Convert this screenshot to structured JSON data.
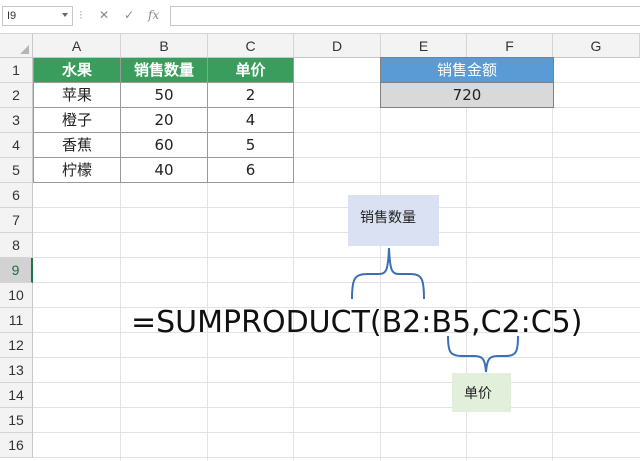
{
  "formula_bar": {
    "name_box": "I9",
    "cancel_icon": "✕",
    "enter_icon": "✓",
    "fx_label": "fx",
    "formula": ""
  },
  "columns": [
    "A",
    "B",
    "C",
    "D",
    "E",
    "F",
    "G"
  ],
  "rows": [
    "1",
    "2",
    "3",
    "4",
    "5",
    "6",
    "7",
    "8",
    "9",
    "10",
    "11",
    "12",
    "13",
    "14",
    "15",
    "16"
  ],
  "selected_row": "9",
  "table": {
    "headers": [
      "水果",
      "销售数量",
      "单价"
    ],
    "rows": [
      [
        "苹果",
        "50",
        "2"
      ],
      [
        "橙子",
        "20",
        "4"
      ],
      [
        "香蕉",
        "60",
        "5"
      ],
      [
        "柠檬",
        "40",
        "6"
      ]
    ],
    "header_color": "#3a9d5d"
  },
  "result": {
    "label": "销售金额",
    "value": "720",
    "label_color": "#5b9bd5"
  },
  "annotation": {
    "formula_text": "=SUMPRODUCT(B2:B5,C2:C5)",
    "qty_label": "销售数量",
    "price_label": "单价",
    "brace_color": "#3b6fb6"
  }
}
